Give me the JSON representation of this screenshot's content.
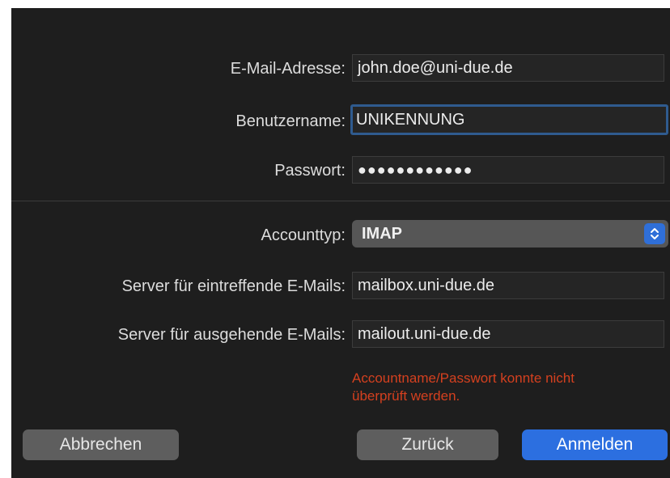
{
  "form": {
    "email": {
      "label": "E-Mail-Adresse:",
      "value": "john.doe@uni-due.de"
    },
    "username": {
      "label": "Benutzername:",
      "value": "UNIKENNUNG"
    },
    "password": {
      "label": "Passwort:",
      "value": "●●●●●●●●●●●●"
    },
    "account_type": {
      "label": "Accounttyp:",
      "value": "IMAP",
      "stepper_icon": "chevron-up-down-icon"
    },
    "incoming_server": {
      "label": "Server für eintreffende E-Mails:",
      "value": "mailbox.uni-due.de"
    },
    "outgoing_server": {
      "label": "Server für ausgehende E-Mails:",
      "value": "mailout.uni-due.de"
    },
    "error_message": {
      "line1": "Accountname/Passwort konnte nicht",
      "line2": "überprüft werden."
    }
  },
  "buttons": {
    "cancel": "Abbrechen",
    "back": "Zurück",
    "sign_in": "Anmelden"
  },
  "colors": {
    "background": "#1e1e1e",
    "accent": "#2c6fe0",
    "error": "#d4401f",
    "focus_ring": "#2f5b8f"
  }
}
